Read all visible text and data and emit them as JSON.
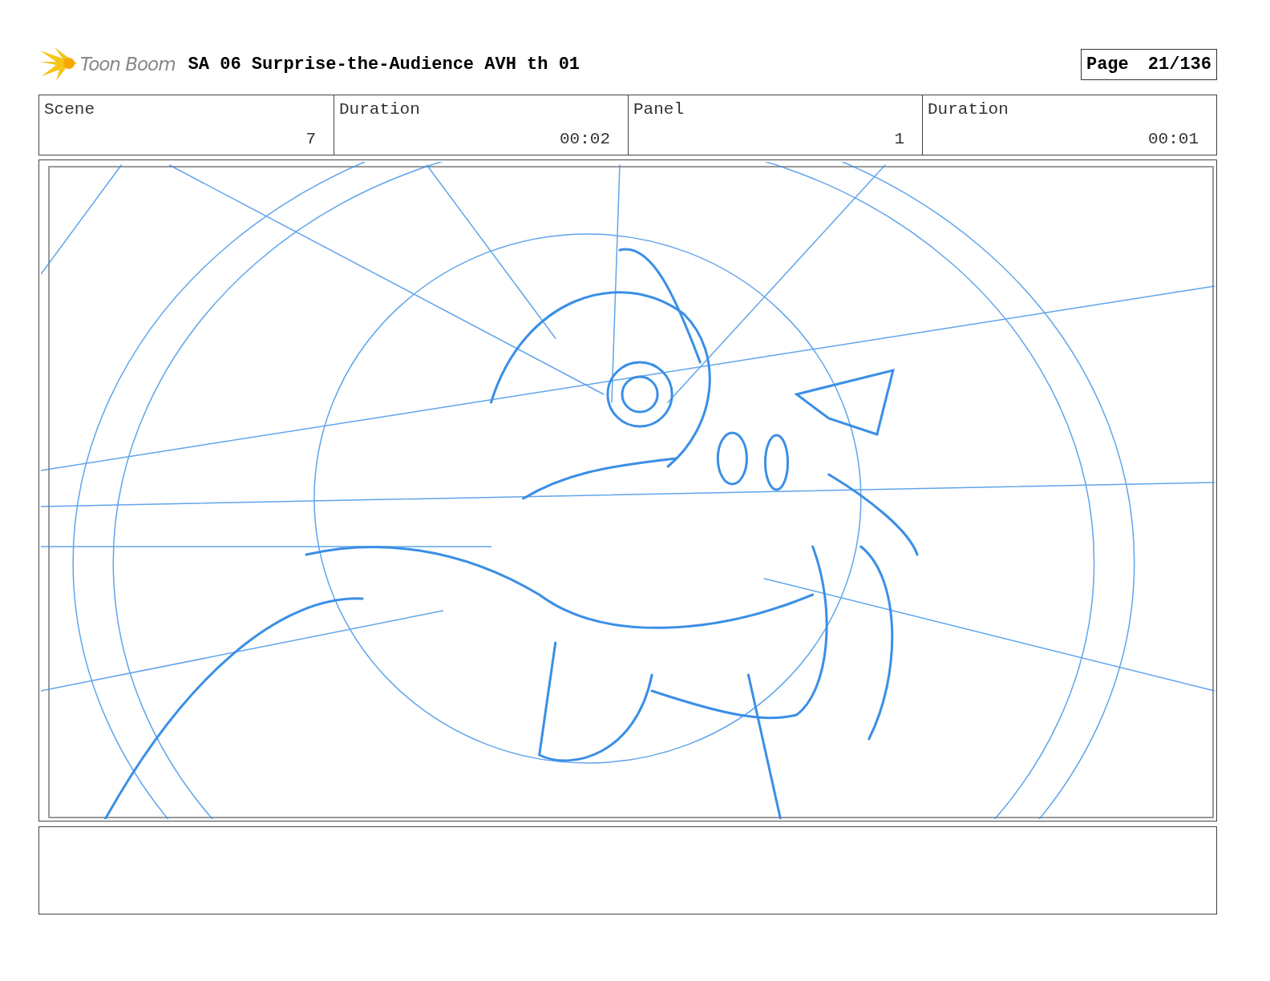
{
  "header": {
    "logo": "Toon Boom",
    "title": "SA 06 Surprise-the-Audience AVH th 01",
    "page_label": "Page",
    "page_number": "21/136"
  },
  "fields": [
    {
      "label": "Scene",
      "value": "7"
    },
    {
      "label": "Duration",
      "value": "00:02"
    },
    {
      "label": "Panel",
      "value": "1"
    },
    {
      "label": "Duration",
      "value": "00:01"
    }
  ]
}
